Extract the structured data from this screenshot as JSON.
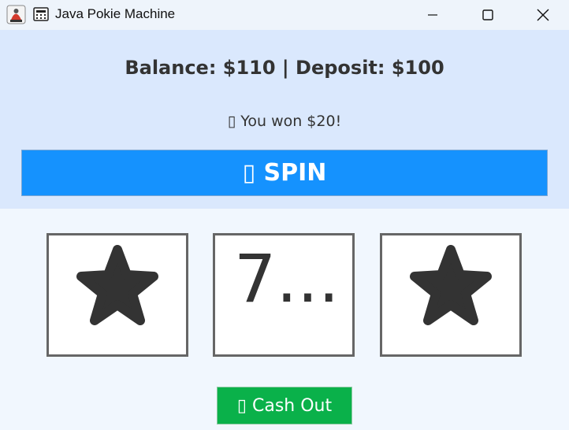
{
  "window": {
    "title": "Java Pokie Machine",
    "icons": {
      "app": "java-app-icon",
      "secondary": "calculator-icon"
    },
    "controls": [
      "minimize-icon",
      "maximize-icon",
      "close-icon"
    ]
  },
  "header": {
    "balance_text": "Balance: $110 | Deposit: $100",
    "message_text": "▯ You won $20!"
  },
  "spin_button": {
    "label": "▯ SPIN",
    "color": "#1592fe"
  },
  "reels": [
    {
      "symbol": "star-icon",
      "text": ""
    },
    {
      "symbol": "seven",
      "text": "7..."
    },
    {
      "symbol": "star-icon",
      "text": ""
    }
  ],
  "cashout_button": {
    "label": "▯ Cash Out",
    "color": "#0ab14a"
  },
  "colors": {
    "panel_bg": "#dae8fd",
    "page_bg": "#f1f7fe",
    "reel_border": "#666666",
    "text": "#333333"
  }
}
